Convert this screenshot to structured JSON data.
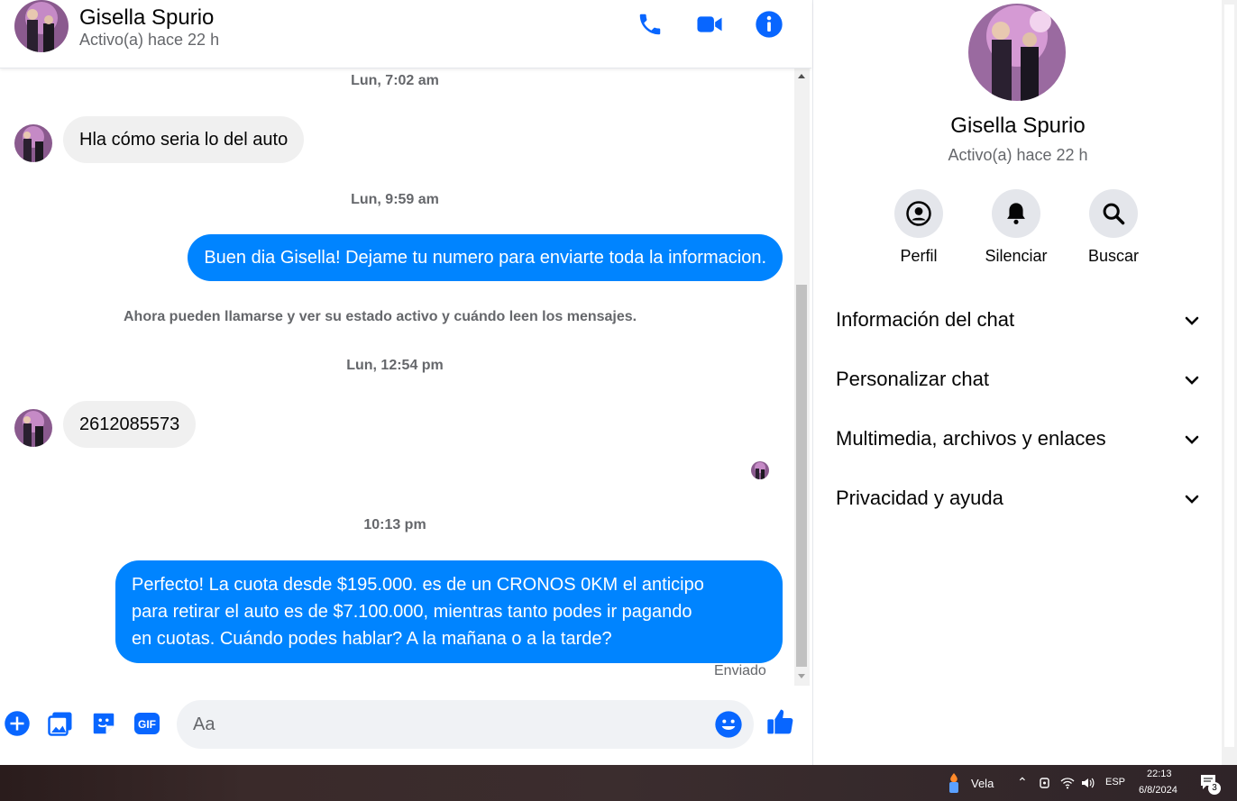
{
  "contact": {
    "name": "Gisella Spurio",
    "status": "Activo(a) hace 22 h"
  },
  "messages": {
    "t1": "Lun, 7:02 am",
    "in1": "Hla cómo seria lo del auto",
    "t2": "Lun, 9:59 am",
    "out1": "Buen dia Gisella! Dejame tu numero para enviarte toda la informacion.",
    "system": "Ahora pueden llamarse y ver su estado activo y cuándo leen los mensajes.",
    "t3": "Lun, 12:54 pm",
    "in2": "2612085573",
    "t4": "10:13 pm",
    "out2_line1": "Perfecto! La cuota desde $195.000. es de un CRONOS 0KM el anticipo",
    "out2_line2": "para retirar el auto es de $7.100.000, mientras tanto podes ir pagando",
    "out2_line3": "en cuotas. Cuándo podes hablar? A la mañana o a la tarde?",
    "sent": "Enviado"
  },
  "composer": {
    "placeholder": "Aa"
  },
  "info": {
    "actions": [
      {
        "label": "Perfil",
        "icon": "profile-icon"
      },
      {
        "label": "Silenciar",
        "icon": "bell-icon"
      },
      {
        "label": "Buscar",
        "icon": "search-icon"
      }
    ],
    "sections": [
      "Información del chat",
      "Personalizar chat",
      "Multimedia, archivos y enlaces",
      "Privacidad y ayuda"
    ]
  },
  "taskbar": {
    "weather": "Vela",
    "lang": "ESP",
    "time": "22:13",
    "date": "6/8/2024",
    "notif_count": "3"
  },
  "colors": {
    "accent": "#0084ff",
    "icon": "#0866ff"
  }
}
